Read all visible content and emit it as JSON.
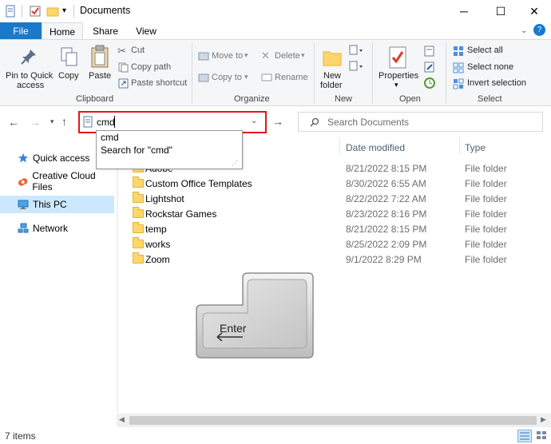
{
  "window": {
    "title": "Documents",
    "minimize": "─",
    "maximize": "☐",
    "close": "✕",
    "help": "?"
  },
  "tabs": {
    "file": "File",
    "home": "Home",
    "share": "Share",
    "view": "View"
  },
  "ribbon": {
    "clipboard": {
      "group": "Clipboard",
      "pin_line1": "Pin to Quick",
      "pin_line2": "access",
      "copy": "Copy",
      "paste": "Paste",
      "cut": "Cut",
      "copy_path": "Copy path",
      "paste_shortcut": "Paste shortcut"
    },
    "organize": {
      "group": "Organize",
      "move_to": "Move to",
      "copy_to": "Copy to",
      "delete": "Delete",
      "rename": "Rename"
    },
    "new": {
      "group": "New",
      "line1": "New",
      "line2": "folder"
    },
    "open": {
      "group": "Open",
      "properties": "Properties"
    },
    "select": {
      "group": "Select",
      "select_all": "Select all",
      "select_none": "Select none",
      "invert": "Invert selection"
    }
  },
  "address": {
    "value": "cmd",
    "suggestions": [
      "cmd",
      "Search for \"cmd\""
    ]
  },
  "search": {
    "placeholder": "Search Documents"
  },
  "nav": [
    "Quick access",
    "Creative Cloud Files",
    "This PC",
    "Network"
  ],
  "columns": {
    "date": "Date modified",
    "type": "Type"
  },
  "files": [
    {
      "name": "Adobe",
      "date": "8/21/2022 8:15 PM",
      "type": "File folder"
    },
    {
      "name": "Custom Office Templates",
      "date": "8/30/2022 6:55 AM",
      "type": "File folder"
    },
    {
      "name": "Lightshot",
      "date": "8/22/2022 7:22 AM",
      "type": "File folder"
    },
    {
      "name": "Rockstar Games",
      "date": "8/23/2022 8:16 PM",
      "type": "File folder"
    },
    {
      "name": "temp",
      "date": "8/21/2022 8:15 PM",
      "type": "File folder"
    },
    {
      "name": "works",
      "date": "8/25/2022 2:09 PM",
      "type": "File folder"
    },
    {
      "name": "Zoom",
      "date": "9/1/2022 8:29 PM",
      "type": "File folder"
    }
  ],
  "key": {
    "label": "Enter"
  },
  "status": {
    "items": "7 items"
  },
  "colors": {
    "file_tab": "#1979ca",
    "highlight": "#e3141f",
    "selected_nav": "#cce8ff"
  }
}
